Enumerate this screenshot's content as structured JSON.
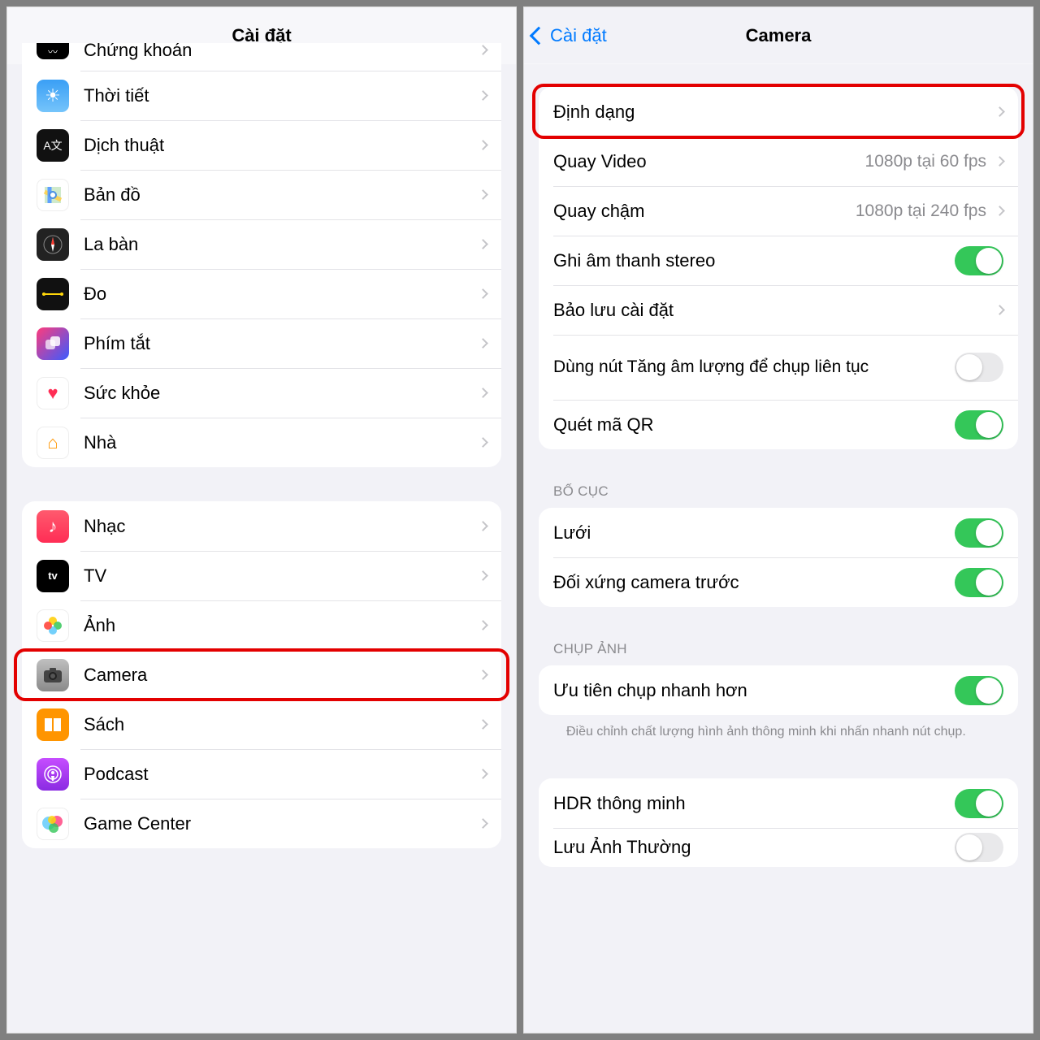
{
  "colors": {
    "accent": "#007aff",
    "toggle_on": "#34c759",
    "highlight": "#e30000"
  },
  "left": {
    "title": "Cài đặt",
    "groups": [
      {
        "rows": [
          {
            "id": "chungkhoan",
            "label": "Chứng khoán",
            "icon": "stocks-icon"
          },
          {
            "id": "thoi-tiet",
            "label": "Thời tiết",
            "icon": "weather-icon"
          },
          {
            "id": "dich-thuat",
            "label": "Dịch thuật",
            "icon": "translate-icon"
          },
          {
            "id": "ban-do",
            "label": "Bản đồ",
            "icon": "maps-icon"
          },
          {
            "id": "la-ban",
            "label": "La bàn",
            "icon": "compass-icon"
          },
          {
            "id": "do",
            "label": "Đo",
            "icon": "measure-icon"
          },
          {
            "id": "phim-tat",
            "label": "Phím tắt",
            "icon": "shortcuts-icon"
          },
          {
            "id": "suc-khoe",
            "label": "Sức khỏe",
            "icon": "health-icon"
          },
          {
            "id": "nha",
            "label": "Nhà",
            "icon": "home-icon"
          }
        ]
      },
      {
        "rows": [
          {
            "id": "nhac",
            "label": "Nhạc",
            "icon": "music-icon"
          },
          {
            "id": "tv",
            "label": "TV",
            "icon": "tv-icon"
          },
          {
            "id": "anh",
            "label": "Ảnh",
            "icon": "photos-icon"
          },
          {
            "id": "camera",
            "label": "Camera",
            "icon": "camera-icon",
            "highlighted": true
          },
          {
            "id": "sach",
            "label": "Sách",
            "icon": "books-icon"
          },
          {
            "id": "podcast",
            "label": "Podcast",
            "icon": "podcast-icon"
          },
          {
            "id": "game-center",
            "label": "Game Center",
            "icon": "gamecenter-icon"
          }
        ]
      }
    ]
  },
  "right": {
    "back_label": "Cài đặt",
    "title": "Camera",
    "groups": [
      {
        "rows": [
          {
            "id": "dinh-dang",
            "label": "Định dạng",
            "type": "link",
            "highlighted": true
          },
          {
            "id": "quay-video",
            "label": "Quay Video",
            "value": "1080p tại 60 fps",
            "type": "link"
          },
          {
            "id": "quay-cham",
            "label": "Quay chậm",
            "value": "1080p tại 240 fps",
            "type": "link"
          },
          {
            "id": "ghi-am-stereo",
            "label": "Ghi âm thanh stereo",
            "type": "toggle",
            "on": true
          },
          {
            "id": "bao-luu",
            "label": "Bảo lưu cài đặt",
            "type": "link"
          },
          {
            "id": "nut-tang-am",
            "label": "Dùng nút Tăng âm lượng để chụp liên tục",
            "type": "toggle",
            "on": false,
            "tall": true
          },
          {
            "id": "quet-qr",
            "label": "Quét mã QR",
            "type": "toggle",
            "on": true
          }
        ]
      },
      {
        "header": "BỐ CỤC",
        "rows": [
          {
            "id": "luoi",
            "label": "Lưới",
            "type": "toggle",
            "on": true
          },
          {
            "id": "doi-xung",
            "label": "Đối xứng camera trước",
            "type": "toggle",
            "on": true
          }
        ]
      },
      {
        "header": "CHỤP ẢNH",
        "rows": [
          {
            "id": "uu-tien-nhanh",
            "label": "Ưu tiên chụp nhanh hơn",
            "type": "toggle",
            "on": true
          }
        ],
        "footer": "Điều chỉnh chất lượng hình ảnh thông minh khi nhấn nhanh nút chụp."
      },
      {
        "rows": [
          {
            "id": "hdr",
            "label": "HDR thông minh",
            "type": "toggle",
            "on": true
          },
          {
            "id": "luu-anh-thuong",
            "label": "Lưu Ảnh Thường",
            "type": "toggle",
            "on": false
          }
        ]
      }
    ]
  }
}
